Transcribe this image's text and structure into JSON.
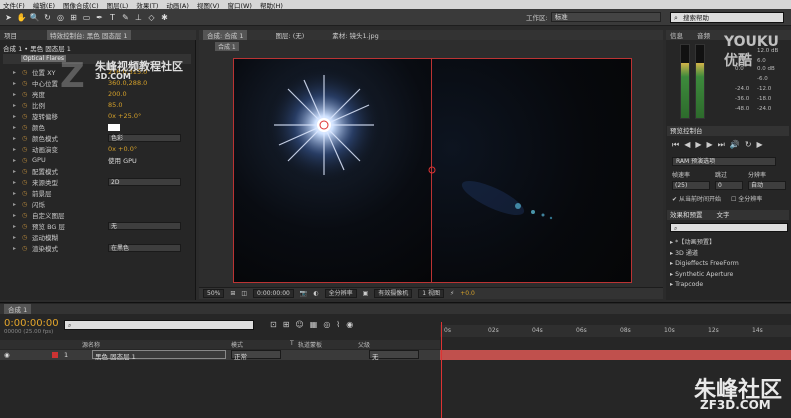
{
  "menu": [
    "文件(F)",
    "编辑(E)",
    "图像合成(C)",
    "图层(L)",
    "效果(T)",
    "动画(A)",
    "视图(V)",
    "窗口(W)",
    "帮助(H)"
  ],
  "workspace": {
    "label": "工作区:",
    "value": "标准",
    "search_placeholder": "搜索帮助"
  },
  "left_panel": {
    "tabs": [
      "项目",
      "特效控制台: 黑色 固态层 1"
    ],
    "breadcrumb": "合成 1 • 黑色 固态层 1",
    "effect_name": "Optical Flares",
    "props": [
      {
        "label": "位置 XY",
        "value": "216.0,315.0"
      },
      {
        "label": "中心位置",
        "value": "360.0,288.0"
      },
      {
        "label": "亮度",
        "value": "200.0"
      },
      {
        "label": "比例",
        "value": "85.0"
      },
      {
        "label": "旋转偏移",
        "value": "0x +25.0°"
      },
      {
        "label": "颜色",
        "value": ""
      },
      {
        "label": "颜色模式",
        "dropdown": "色彩"
      },
      {
        "label": "动画演变",
        "value": "0x +0.0°"
      },
      {
        "label": "GPU",
        "check": "使用 GPU"
      },
      {
        "label": "配置模式",
        "value": ""
      },
      {
        "label": "来源类型",
        "dropdown": "2D"
      },
      {
        "label": "前景层",
        "value": ""
      },
      {
        "label": "闪烁",
        "value": ""
      },
      {
        "label": "自定义图层",
        "value": ""
      },
      {
        "label": "预览 BG 层",
        "dropdown": "无"
      },
      {
        "label": "运动模糊",
        "value": ""
      },
      {
        "label": "渲染模式",
        "dropdown": "在黑色"
      }
    ]
  },
  "viewer": {
    "tabs": [
      "合成: 合成 1",
      "图层: (无)",
      "素材: 镜头1.jpg"
    ],
    "sub_tab": "合成 1",
    "toolbar": {
      "zoom": "50%",
      "timecode": "0:00:00:00",
      "resolution": "全分辨率",
      "camera": "有效摄像机",
      "views": "1 视图",
      "offset": "+0.0"
    }
  },
  "right_panel": {
    "tabs": [
      "信息",
      "音频"
    ],
    "meter_ticks": [
      "12.0 dB",
      "6.0",
      "0.0 dB",
      "-6.0",
      "-12.0",
      "-18.0",
      "-24.0"
    ],
    "meter_values": [
      "0.0",
      "-24.0",
      "-36.0",
      "-48.0"
    ],
    "preview": {
      "title": "预览控制台",
      "ram_option": "RAM 预演选项",
      "fps_label": "帧速率",
      "skip_label": "跳过",
      "res_label": "分辨率",
      "fps": "(25)",
      "skip": "0",
      "res": "自动",
      "from_current": "从当前时间开始",
      "full_screen": "全分辨率"
    },
    "effects": {
      "tabs": [
        "效果和预置",
        "文字"
      ],
      "items": [
        "*【动画预置】",
        "3D 通道",
        "Digieffects FreeForm",
        "Synthetic Aperture",
        "Trapcode"
      ]
    }
  },
  "timeline": {
    "tab": "合成 1",
    "timecode": "0:00:00:00",
    "fps_info": "00000 (25.00 fps)",
    "ruler": [
      "0s",
      "02s",
      "04s",
      "06s",
      "08s",
      "10s",
      "12s",
      "14s"
    ],
    "cols": [
      "源名称",
      "模式",
      "T",
      "轨道蒙板",
      "父级"
    ],
    "layer": {
      "num": "1",
      "name": "黑色 固态层 1",
      "mode": "正常",
      "parent": "无"
    }
  },
  "watermarks": {
    "brand": "朱峰视频教程社区",
    "brand_url": "3D.COM",
    "youku": "YOUKU 优酷",
    "footer": "朱峰社区",
    "footer_url": "ZF3D.COM"
  }
}
